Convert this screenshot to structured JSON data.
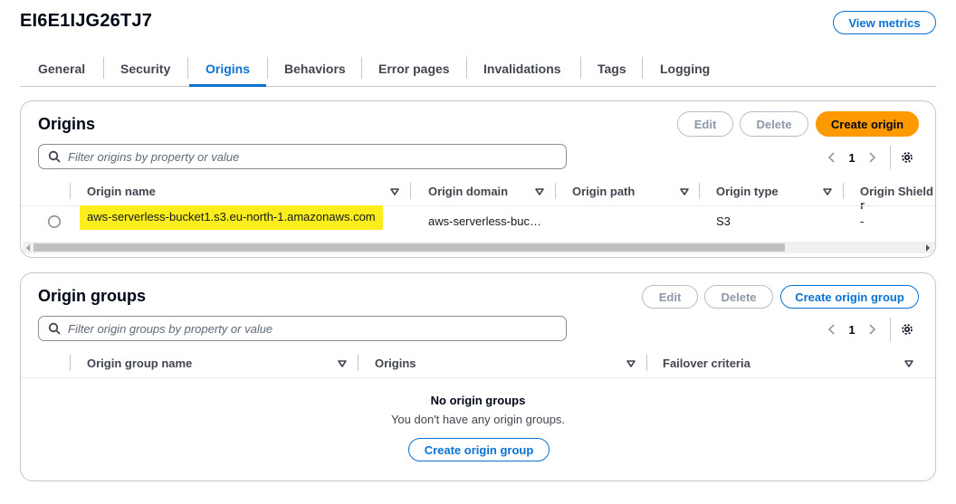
{
  "distribution": {
    "id": "EI6E1IJG26TJ7"
  },
  "header": {
    "view_metrics": "View metrics"
  },
  "tabs": [
    {
      "label": "General"
    },
    {
      "label": "Security"
    },
    {
      "label": "Origins",
      "active": true
    },
    {
      "label": "Behaviors"
    },
    {
      "label": "Error pages"
    },
    {
      "label": "Invalidations"
    },
    {
      "label": "Tags"
    },
    {
      "label": "Logging"
    }
  ],
  "origins": {
    "title": "Origins",
    "edit": "Edit",
    "delete": "Delete",
    "create": "Create origin",
    "filter_placeholder": "Filter origins by property or value",
    "page": "1",
    "columns": [
      "Origin name",
      "Origin domain",
      "Origin path",
      "Origin type",
      "Origin Shield r"
    ],
    "rows": [
      {
        "name": "aws-serverless-bucket1.s3.eu-north-1.amazonaws.com",
        "domain": "aws-serverless-buc…",
        "path": "",
        "type": "S3",
        "shield": "-"
      }
    ]
  },
  "origin_groups": {
    "title": "Origin groups",
    "edit": "Edit",
    "delete": "Delete",
    "create": "Create origin group",
    "filter_placeholder": "Filter origin groups by property or value",
    "page": "1",
    "columns": [
      "Origin group name",
      "Origins",
      "Failover criteria"
    ],
    "empty_title": "No origin groups",
    "empty_desc": "You don't have any origin groups.",
    "empty_create": "Create origin group"
  },
  "colors": {
    "accent": "#0972d3",
    "primary_button": "#ff9900",
    "highlight": "#fbee1c"
  }
}
